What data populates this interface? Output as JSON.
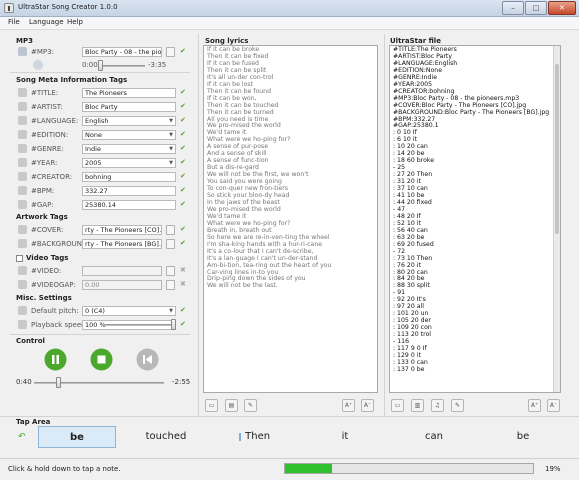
{
  "window": {
    "title": "UltraStar Song Creator 1.0.0",
    "minimize": "–",
    "maximize": "□",
    "close": "✕"
  },
  "menu": [
    "File",
    "Language",
    "Help"
  ],
  "mp3": {
    "section_title": "MP3",
    "tag_label": "#MP3:",
    "value": "Bloc Party - 08 - the pioneers.mp3",
    "time_start": "0:00",
    "time_end": "-3:35",
    "progress_fraction": 0.0
  },
  "meta": {
    "section_title": "Song Meta Information Tags",
    "rows": [
      {
        "label": "#TITLE:",
        "value": "The Pioneers",
        "icon": "title-icon",
        "kind": "text"
      },
      {
        "label": "#ARTIST:",
        "value": "Bloc Party",
        "icon": "artist-icon",
        "kind": "text"
      },
      {
        "label": "#LANGUAGE:",
        "value": "English",
        "icon": "language-icon",
        "kind": "combo"
      },
      {
        "label": "#EDITION:",
        "value": "None",
        "icon": "edition-icon",
        "kind": "combo"
      },
      {
        "label": "#GENRE:",
        "value": "Indie",
        "icon": "genre-icon",
        "kind": "combo"
      },
      {
        "label": "#YEAR:",
        "value": "2005",
        "icon": "year-icon",
        "kind": "combo"
      },
      {
        "label": "#CREATOR:",
        "value": "bohning",
        "icon": "creator-icon",
        "kind": "text"
      },
      {
        "label": "#BPM:",
        "value": "332.27",
        "icon": "bpm-icon",
        "kind": "text"
      },
      {
        "label": "#GAP:",
        "value": "25380.14",
        "icon": "gap-icon",
        "kind": "text"
      }
    ]
  },
  "artwork": {
    "section_title": "Artwork Tags",
    "rows": [
      {
        "label": "#COVER:",
        "value": "rty - The Pioneers [CO].jpg",
        "icon": "cover-icon"
      },
      {
        "label": "#BACKGROUND:",
        "value": "rty - The Pioneers [BG].jpg",
        "icon": "background-icon"
      }
    ]
  },
  "video": {
    "section_title": "Video Tags",
    "rows": [
      {
        "label": "#VIDEO:",
        "value": "",
        "icon": "video-icon"
      },
      {
        "label": "#VIDEOGAP:",
        "value": "0.00",
        "icon": "videogap-icon"
      }
    ]
  },
  "misc": {
    "section_title": "Misc. Settings",
    "rows": [
      {
        "label": "Default pitch:",
        "value": "0 (C4)",
        "icon": "pitch-icon"
      },
      {
        "label": "Playback speed:",
        "value": "100 %",
        "icon": "speed-icon"
      }
    ],
    "speed_fraction": 1.0
  },
  "control": {
    "section_title": "Control",
    "time_start": "0:40",
    "time_end": "-2:55",
    "position_fraction": 0.19,
    "colors": {
      "play": "#4aa82c",
      "stop": "#4aa82c",
      "rewind": "#b8b8b8"
    }
  },
  "lyrics": {
    "section_title": "Song lyrics",
    "lines": [
      "If it can be broke",
      "Then it can be fixed",
      "If it can be fused",
      "Then it can be split",
      "It's all un-der con-trol",
      "If it can be lost",
      "Then it can be found",
      "If it can be won,",
      "Then it can be touched",
      "Then it can be turned",
      "All you need is time",
      "We pro-mised the world",
      "We'd tame it",
      "What were we ho-ping for?",
      "A sense of pur-pose",
      "And a sense of skill",
      "A sense of func-tion",
      "But a dis-re-gard",
      "We will not be the first, we won't",
      "You said you were going",
      "To con-quer new fron-tiers",
      "So stick your bloo-dy head",
      "In the jaws of the beast",
      "We pro-mised the world",
      "We'd tame it",
      "What were we ho-ping for?",
      "Breath in, breath out",
      "So here we are re-in-ven-ting the wheel",
      "I'm sha-king hands with a hur-ri-cane",
      "It's a co-lour that I can't de-scribe,",
      "It's a lan-guage I can't un-der-stand",
      "Am-bi-tion, tea-ring out the heart of you",
      "Car-ving lines in-to you",
      "Drip-ping down the sides of you",
      "We will not be the last."
    ]
  },
  "ultrastar": {
    "section_title": "UltraStar file",
    "lines": [
      "#TITLE:The Pioneers",
      "#ARTIST:Bloc Party",
      "#LANGUAGE:English",
      "#EDITION:None",
      "#GENRE:Indie",
      "#YEAR:2005",
      "#CREATOR:bohning",
      "#MP3:Bloc Party - 08 - the pioneers.mp3",
      "#COVER:Bloc Party - The Pioneers [CO].jpg",
      "#BACKGROUND:Bloc Party - The Pioneers [BG].jpg",
      "#BPM:332.27",
      "#GAP:25380.1",
      ": 0 10 If",
      ": 6 10 it",
      ": 10 20 can",
      ": 14 20 be",
      ": 18 60 broke",
      "- 25",
      ": 27 20 Then",
      ": 31 20 it",
      ": 37 10 can",
      ": 41 10 be",
      ": 44 20 fixed",
      "- 47",
      ": 48 20 If",
      ": 52 10 it",
      ": 56 40 can",
      ": 63 20 be",
      ": 69 20 fused",
      "- 72",
      ": 73 10 Then",
      ": 76 20 it",
      ": 80 20 can",
      ": 84 20 be",
      ": 88 30 split",
      "- 91",
      ": 92 20 It's",
      ": 97 20 all",
      ": 101 20 un",
      ": 105 20 der",
      ": 109 20 con",
      ": 113 20 trol",
      "- 116",
      ": 117 9 0 If",
      ": 129 0 it",
      ": 133 0 can",
      ": 137 0 be"
    ]
  },
  "taparea": {
    "section_title": "Tap Area",
    "words": [
      "be",
      "touched",
      "Then",
      "it",
      "can",
      "be"
    ]
  },
  "status": {
    "hint": "Click & hold down to tap a note.",
    "progress_percent": 19,
    "progress_label": "19%",
    "bar_color": "#2fbf2f"
  }
}
